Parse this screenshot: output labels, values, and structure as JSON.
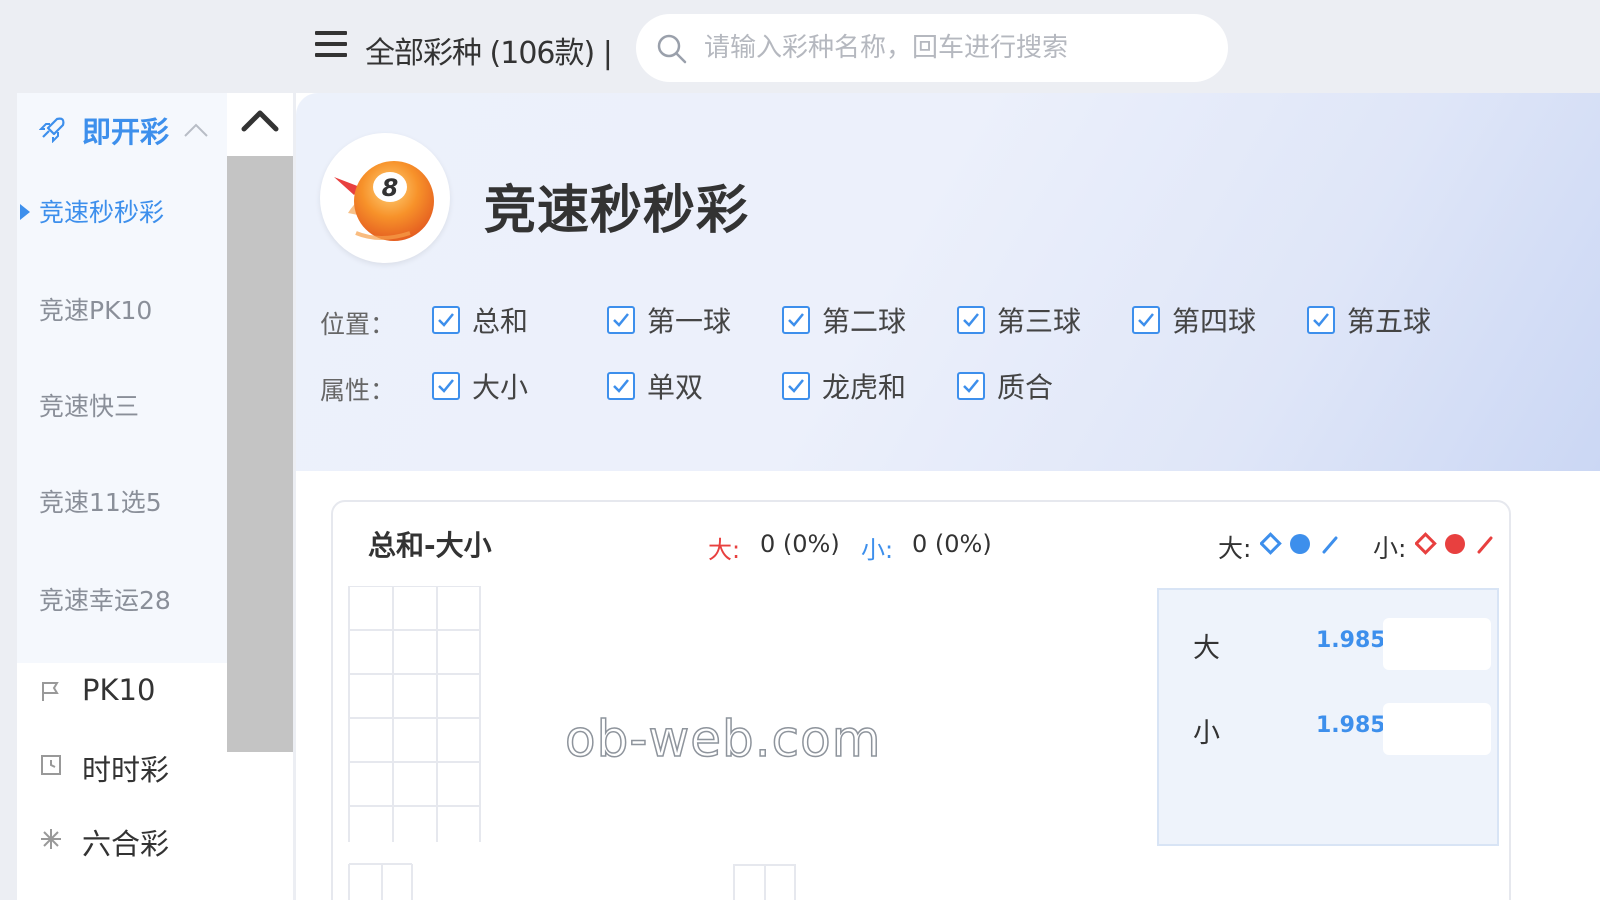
{
  "header": {
    "all_lottery_label": "全部彩种 (106款) |",
    "search_placeholder": "请输入彩种名称，回车进行搜索"
  },
  "sidebar": {
    "group_title": "即开彩",
    "sub_items": [
      "竞速秒秒彩",
      "竞速PK10",
      "竞速快三",
      "竞速11选5",
      "竞速幸运28"
    ],
    "active_index": 0,
    "items": [
      {
        "label": "PK10",
        "icon": "flag-icon"
      },
      {
        "label": "时时彩",
        "icon": "clock-icon"
      },
      {
        "label": "六合彩",
        "icon": "sparkle-icon"
      }
    ]
  },
  "main": {
    "lottery_title": "竞速秒秒彩",
    "position_label": "位置：",
    "position_options": [
      "总和",
      "第一球",
      "第二球",
      "第三球",
      "第四球",
      "第五球"
    ],
    "attribute_label": "属性：",
    "attribute_options": [
      "大小",
      "单双",
      "龙虎和",
      "质合"
    ],
    "card": {
      "title": "总和-大小",
      "big_label": "大:",
      "big_value": "0 (0%)",
      "small_label": "小:",
      "small_value": "0 (0%)",
      "legend_big": "大:",
      "legend_small": "小:",
      "odds": [
        {
          "name": "大",
          "value": "1.985"
        },
        {
          "name": "小",
          "value": "1.985"
        }
      ]
    },
    "watermark": "ob-web.com"
  },
  "colors": {
    "accent_blue": "#3d8fec",
    "accent_red": "#e8403f"
  }
}
